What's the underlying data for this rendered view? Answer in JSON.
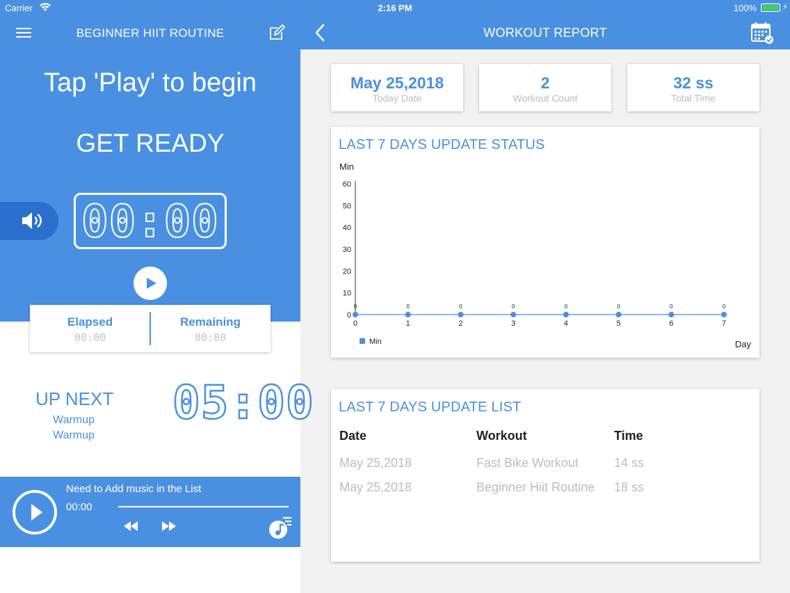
{
  "status_bar": {
    "carrier": "Carrier",
    "time": "2:16 PM",
    "battery": "100%"
  },
  "left_panel": {
    "title": "BEGINNER HIIT ROUTINE",
    "instruction": "Tap 'Play' to begin",
    "phase": "GET READY",
    "timer": "00:00",
    "elapsed_label": "Elapsed",
    "elapsed_value": "00:00",
    "remaining_label": "Remaining",
    "remaining_value": "00:00",
    "up_next_label": "UP NEXT",
    "up_next_items": [
      "Warmup",
      "Warmup"
    ],
    "up_next_time": "05:00",
    "accent_color": "#4a90e2"
  },
  "music_player": {
    "song_title": "Need to Add music in the List",
    "current_time": "00:00"
  },
  "right_panel": {
    "title": "WORKOUT REPORT",
    "stats": [
      {
        "value": "May 25,2018",
        "label": "Today Date"
      },
      {
        "value": "2",
        "label": "Workout Count"
      },
      {
        "value": "32 ss",
        "label": "Total Time"
      }
    ]
  },
  "chart_section": {
    "title": "LAST 7 DAYS UPDATE STATUS"
  },
  "chart_data": {
    "type": "line",
    "ylabel": "Min",
    "xlabel": "Day",
    "x": [
      0,
      1,
      2,
      3,
      4,
      5,
      6,
      7
    ],
    "y_ticks": [
      0,
      10,
      20,
      30,
      40,
      50,
      60
    ],
    "ylim": [
      0,
      60
    ],
    "series": [
      {
        "name": "Min",
        "values": [
          0,
          0,
          0,
          0,
          0,
          0,
          0,
          0
        ],
        "color": "#4a90e2"
      }
    ],
    "legend": "bottom-left",
    "grid": false
  },
  "list_section": {
    "title": "LAST 7 DAYS UPDATE LIST",
    "columns": [
      "Date",
      "Workout",
      "Time"
    ],
    "rows": [
      [
        "May 25,2018",
        "Fast Bike Workout",
        "14 ss"
      ],
      [
        "May 25,2018",
        "Beginner Hiit Routine",
        "18 ss"
      ]
    ]
  }
}
